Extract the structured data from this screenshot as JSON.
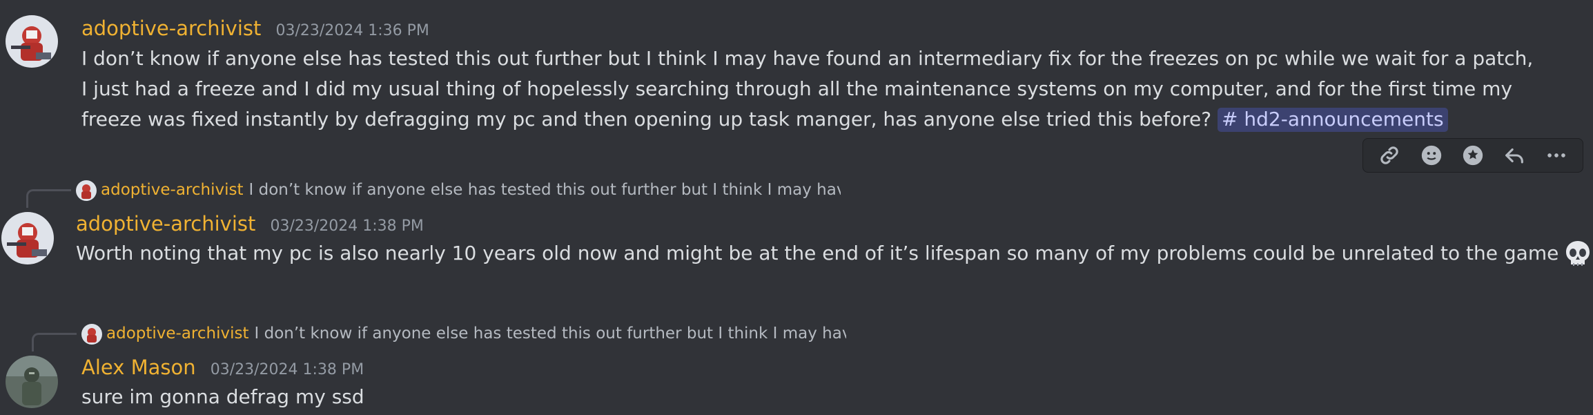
{
  "messages": [
    {
      "username": "adoptive-archivist",
      "timestamp": "03/23/2024 1:36 PM",
      "text": "I don’t know if anyone else has tested this out further but I think I may have found an intermediary fix for the freezes on pc while we wait for a patch, I just had a freeze and I did my usual thing of hopelessly searching through all the maintenance systems on my computer, and for the first time my freeze was fixed instantly by defragging my pc and then opening up task manger, has anyone else tried this before?",
      "mention": "# hd2-announcements"
    },
    {
      "reply": {
        "username": "adoptive-archivist",
        "text": "I don’t know if anyone else has tested this out further but I think I may have found an intermediary fix for the freezes on pc while we wait for a patch, I just ha"
      },
      "username": "adoptive-archivist",
      "timestamp": "03/23/2024 1:38 PM",
      "text": "Worth noting that my pc is also nearly 10 years old now and might be at the end of it’s lifespan so many of my problems could be unrelated to the game",
      "emoji": "skull-emoji"
    },
    {
      "reply": {
        "username": "adoptive-archivist",
        "text": "I don’t know if anyone else has tested this out further but I think I may have found an intermediary fix for the freezes on pc while we wait for a patch, I just ha"
      },
      "username": "Alex Mason",
      "timestamp": "03/23/2024 1:38 PM",
      "text": "sure im gonna defrag my ssd"
    }
  ],
  "toolbar_icons": [
    "link-icon",
    "add-reaction-icon",
    "super-reaction-icon",
    "reply-icon",
    "more-icon"
  ],
  "colors": {
    "background": "#313338",
    "username": "#f0b232",
    "text": "#dbdee1",
    "timestamp": "#949ba4",
    "mention_bg": "#3c4270",
    "mention_text": "#c9cdfb"
  }
}
